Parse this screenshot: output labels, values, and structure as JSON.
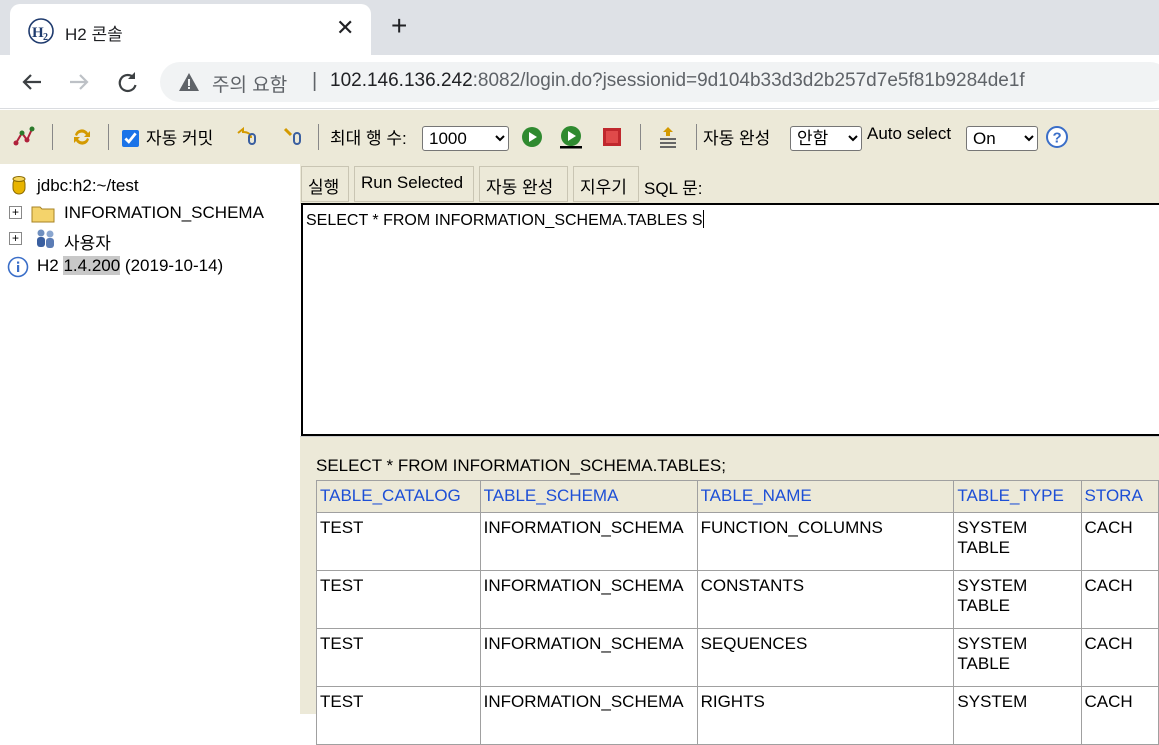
{
  "browser": {
    "tab_title": "H2 콘솔",
    "tab_close": "✕",
    "new_tab": "+",
    "security_warning": "주의 요함",
    "omnibox_separator": "|",
    "url_host": "102.146.136.242",
    "url_rest": ":8082/login.do?jsessionid=9d104b33d3d2b257d7e5f81b9284de1f"
  },
  "toolbar": {
    "auto_commit_label": "자동 커밋",
    "auto_commit_checked": true,
    "max_rows_label": "최대 행 수:",
    "max_rows_value": "1000",
    "autocomplete_label": "자동 완성",
    "autocomplete_value": "안함",
    "auto_select_label": "Auto select",
    "auto_select_value": "On"
  },
  "tree": {
    "connection": "jdbc:h2:~/test",
    "schema": "INFORMATION_SCHEMA",
    "users": "사용자",
    "version_prefix": "H2 ",
    "version": "1.4.200",
    "version_date": " (2019-10-14)"
  },
  "editor": {
    "buttons": {
      "execute": "실행",
      "run_selected": "Run Selected",
      "autocomplete": "자동 완성",
      "clear": "지우기"
    },
    "sql_label": "SQL 문:",
    "sql_text": "SELECT * FROM INFORMATION_SCHEMA.TABLES S"
  },
  "result": {
    "query": "SELECT * FROM INFORMATION_SCHEMA.TABLES;",
    "columns": [
      "TABLE_CATALOG",
      "TABLE_SCHEMA",
      "TABLE_NAME",
      "TABLE_TYPE",
      "STORA"
    ],
    "rows": [
      [
        "TEST",
        "INFORMATION_SCHEMA",
        "FUNCTION_COLUMNS",
        "SYSTEM TABLE",
        "CACH"
      ],
      [
        "TEST",
        "INFORMATION_SCHEMA",
        "CONSTANTS",
        "SYSTEM TABLE",
        "CACH"
      ],
      [
        "TEST",
        "INFORMATION_SCHEMA",
        "SEQUENCES",
        "SYSTEM TABLE",
        "CACH"
      ],
      [
        "TEST",
        "INFORMATION_SCHEMA",
        "RIGHTS",
        "SYSTEM",
        "CACH"
      ]
    ]
  },
  "colors": {
    "panel_bg": "#ece9d8",
    "column_header_text": "#1d4fd6"
  }
}
